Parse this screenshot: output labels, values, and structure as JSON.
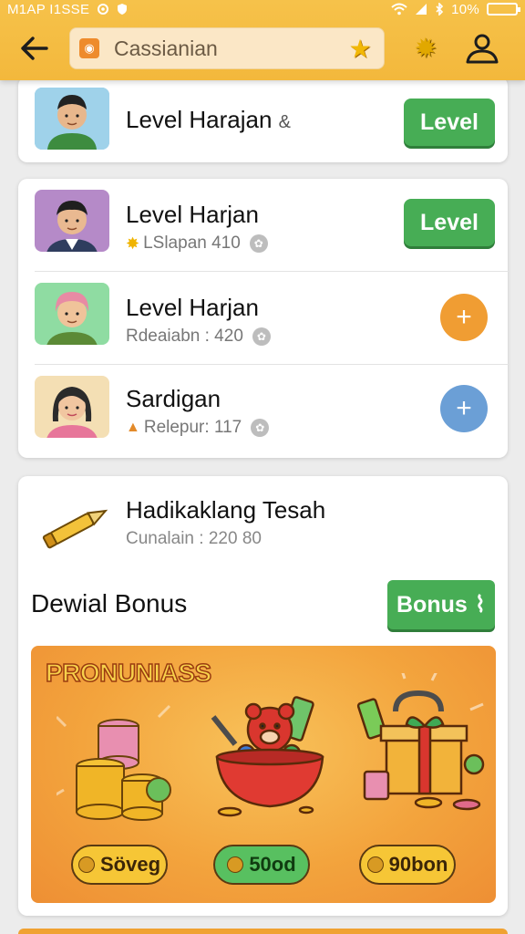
{
  "status_bar": {
    "left_text": "M1AP I1SSE",
    "battery": "10%"
  },
  "header": {
    "search_query": "Cassianian",
    "app_icon_glyph": "◉",
    "icons": [
      "back-arrow-icon",
      "star-icon",
      "sun-badge-icon",
      "user-icon"
    ]
  },
  "top_card": {
    "title": "Level Harajan",
    "title_suffix": "&",
    "button": "Level"
  },
  "list_card": {
    "rows": [
      {
        "title": "Level Harjan",
        "sub_prefix": "✸",
        "sub": "LSlapan 410",
        "action": "Level",
        "action_type": "button"
      },
      {
        "title": "Level Harjan",
        "sub_prefix": "",
        "sub": "Rdeaiabn : 420",
        "action": "+",
        "action_type": "plus",
        "action_color": "#f09d33"
      },
      {
        "title": "Sardigan",
        "sub_prefix": "▲",
        "sub": "Relepur: 117",
        "action": "+",
        "action_type": "plus",
        "action_color": "#6b9fd6"
      }
    ]
  },
  "bonus_card": {
    "item_title": "Hadikaklang Tesah",
    "item_sub": "Cunalain : 220 80",
    "section_title": "Dewial Bonus",
    "bonus_button": "Bonus",
    "bonus_button_icon": "⌇",
    "promo": {
      "title": "PRONUNIASS",
      "pills": [
        {
          "label": "Söveg",
          "bg": "#f6c636"
        },
        {
          "label": "50od",
          "bg": "#58c060"
        },
        {
          "label": "90bon",
          "bg": "#f6c636"
        }
      ]
    }
  },
  "colors": {
    "header": "#f3b83c",
    "green_button": "#47ad55",
    "orange_plus": "#f09d33",
    "blue_plus": "#6b9fd6"
  }
}
